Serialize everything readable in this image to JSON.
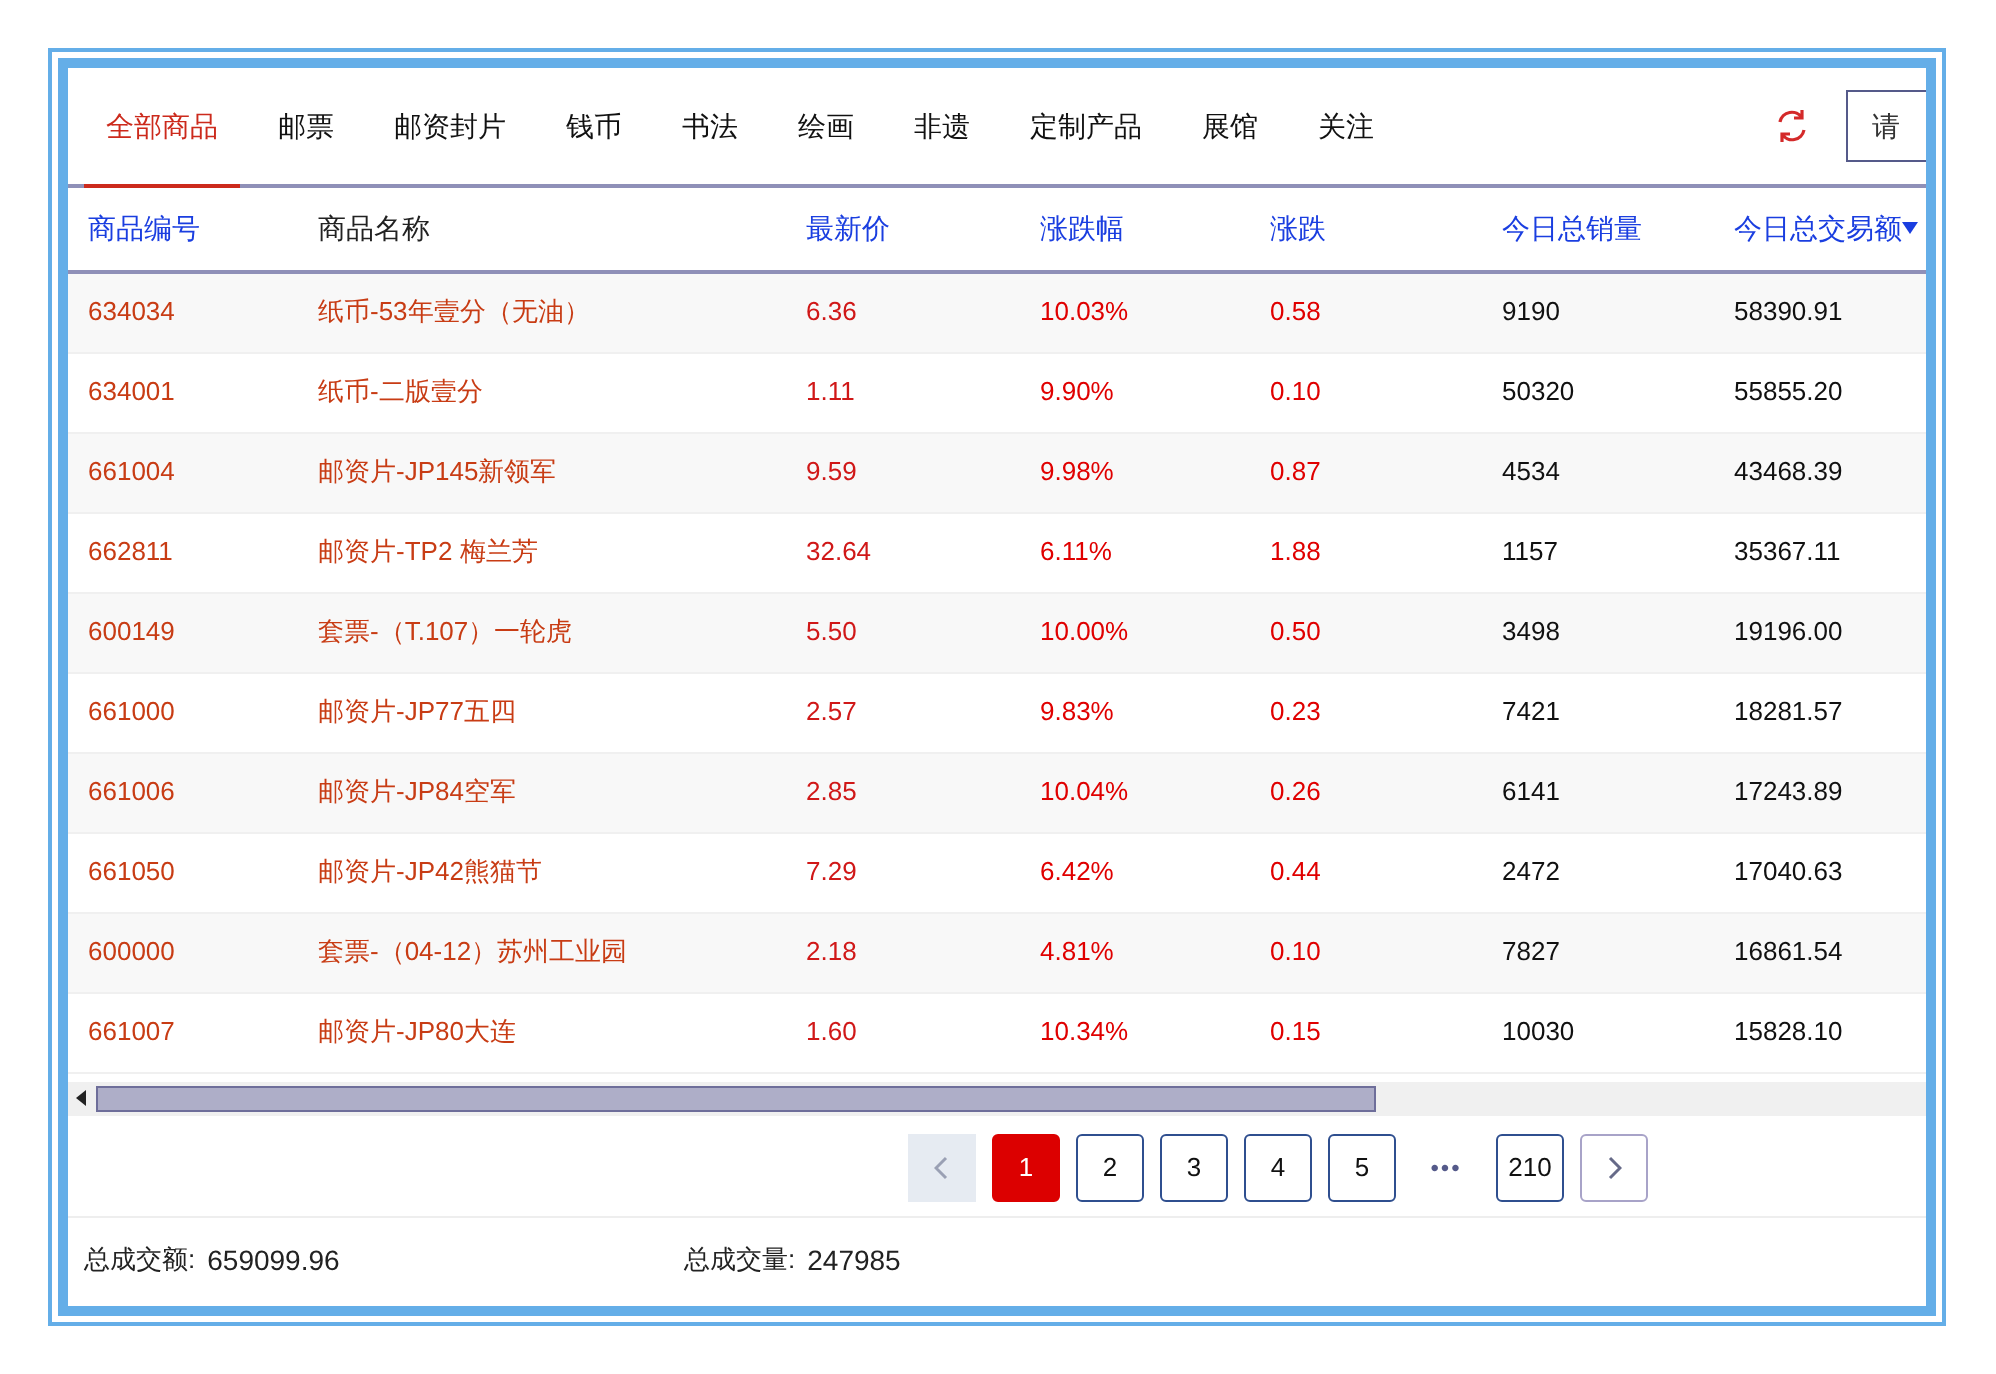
{
  "tabs": [
    {
      "label": "全部商品",
      "selected": true
    },
    {
      "label": "邮票",
      "selected": false
    },
    {
      "label": "邮资封片",
      "selected": false
    },
    {
      "label": "钱币",
      "selected": false
    },
    {
      "label": "书法",
      "selected": false
    },
    {
      "label": "绘画",
      "selected": false
    },
    {
      "label": "非遗",
      "selected": false
    },
    {
      "label": "定制产品",
      "selected": false
    },
    {
      "label": "展馆",
      "selected": false
    },
    {
      "label": "关注",
      "selected": false
    }
  ],
  "search": {
    "placeholder": "请"
  },
  "table": {
    "columns": [
      {
        "label": "商品编号",
        "sortable": true,
        "sorted": false
      },
      {
        "label": "商品名称",
        "sortable": false,
        "sorted": false
      },
      {
        "label": "最新价",
        "sortable": true,
        "sorted": false
      },
      {
        "label": "涨跌幅",
        "sortable": true,
        "sorted": false
      },
      {
        "label": "涨跌",
        "sortable": true,
        "sorted": false
      },
      {
        "label": "今日总销量",
        "sortable": true,
        "sorted": false
      },
      {
        "label": "今日总交易额",
        "sortable": true,
        "sorted": true
      }
    ],
    "rows": [
      [
        "634034",
        "纸币-53年壹分（无油）",
        "6.36",
        "10.03%",
        "0.58",
        "9190",
        "58390.91"
      ],
      [
        "634001",
        "纸币-二版壹分",
        "1.11",
        "9.90%",
        "0.10",
        "50320",
        "55855.20"
      ],
      [
        "661004",
        "邮资片-JP145新领军",
        "9.59",
        "9.98%",
        "0.87",
        "4534",
        "43468.39"
      ],
      [
        "662811",
        "邮资片-TP2 梅兰芳",
        "32.64",
        "6.11%",
        "1.88",
        "1157",
        "35367.11"
      ],
      [
        "600149",
        "套票-（T.107）一轮虎",
        "5.50",
        "10.00%",
        "0.50",
        "3498",
        "19196.00"
      ],
      [
        "661000",
        "邮资片-JP77五四",
        "2.57",
        "9.83%",
        "0.23",
        "7421",
        "18281.57"
      ],
      [
        "661006",
        "邮资片-JP84空军",
        "2.85",
        "10.04%",
        "0.26",
        "6141",
        "17243.89"
      ],
      [
        "661050",
        "邮资片-JP42熊猫节",
        "7.29",
        "6.42%",
        "0.44",
        "2472",
        "17040.63"
      ],
      [
        "600000",
        "套票-（04-12）苏州工业园",
        "2.18",
        "4.81%",
        "0.10",
        "7827",
        "16861.54"
      ],
      [
        "661007",
        "邮资片-JP80大连",
        "1.60",
        "10.34%",
        "0.15",
        "10030",
        "15828.10"
      ]
    ]
  },
  "pagination": {
    "prev": {
      "disabled": true
    },
    "pages": [
      {
        "kind": "page",
        "label": "1",
        "selected": true
      },
      {
        "kind": "page",
        "label": "2",
        "selected": false
      },
      {
        "kind": "page",
        "label": "3",
        "selected": false
      },
      {
        "kind": "page",
        "label": "4",
        "selected": false
      },
      {
        "kind": "page",
        "label": "5",
        "selected": false
      },
      {
        "kind": "ellipsis",
        "label": "•••"
      },
      {
        "kind": "page",
        "label": "210",
        "selected": false
      }
    ],
    "next": {
      "disabled": false
    }
  },
  "summary": [
    {
      "label": "总成交额:",
      "value": "659099.96"
    },
    {
      "label": "总成交量:",
      "value": "247985"
    }
  ]
}
